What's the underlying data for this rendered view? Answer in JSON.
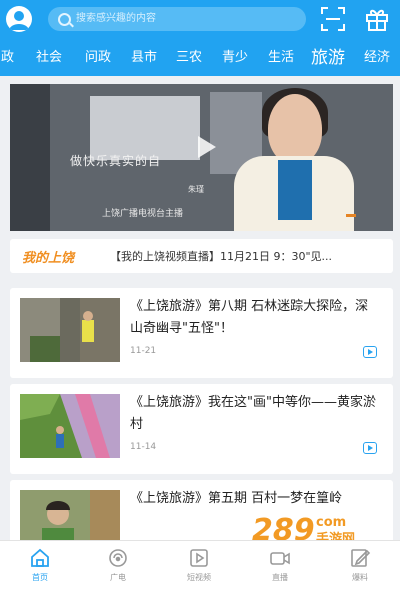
{
  "header": {
    "search_placeholder": "搜索感兴趣的内容",
    "tabs": [
      {
        "label": "政",
        "active": false
      },
      {
        "label": "社会",
        "active": false
      },
      {
        "label": "问政",
        "active": false
      },
      {
        "label": "县市",
        "active": false
      },
      {
        "label": "三农",
        "active": false
      },
      {
        "label": "青少",
        "active": false
      },
      {
        "label": "生活",
        "active": false
      },
      {
        "label": "旅游",
        "active": true
      },
      {
        "label": "经济",
        "active": false
      }
    ]
  },
  "hero": {
    "caption": "做快乐真实的自",
    "name": "朱瑾",
    "subtitle": "上饶广播电视台主播"
  },
  "live": {
    "logo": "我的上饶",
    "text": "【我的上饶视频直播】11月21日 9：30\"见..."
  },
  "articles": [
    {
      "title": "《上饶旅游》第八期 石林迷踪大探险，深山奇幽寻\"五怪\"！",
      "date": "11-21"
    },
    {
      "title": "《上饶旅游》我在这\"画\"中等你——黄家淤村",
      "date": "11-14"
    },
    {
      "title": "《上饶旅游》第五期 百村一梦在篁岭",
      "date": ""
    }
  ],
  "bottom_nav": [
    {
      "label": "首页",
      "icon": "home-icon",
      "active": true
    },
    {
      "label": "广电",
      "icon": "broadcast-icon",
      "active": false
    },
    {
      "label": "短视频",
      "icon": "short-video-icon",
      "active": false
    },
    {
      "label": "直播",
      "icon": "live-icon",
      "active": false
    },
    {
      "label": "爆料",
      "icon": "report-icon",
      "active": false
    }
  ],
  "watermark": {
    "brand": "289",
    "suffix": "com",
    "site": "手游网"
  },
  "colors": {
    "primary": "#21a3f1",
    "accent": "#f08f22"
  }
}
